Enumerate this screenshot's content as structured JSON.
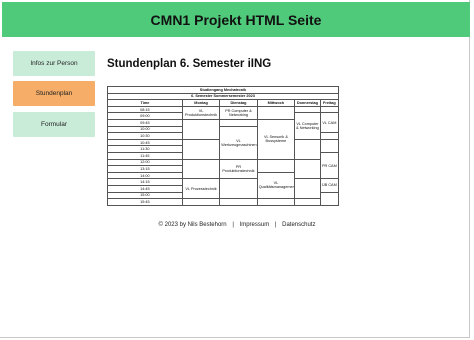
{
  "header": {
    "title": "CMN1 Projekt HTML Seite"
  },
  "nav": [
    {
      "label": "Infos zur Person",
      "active": false
    },
    {
      "label": "Stundenplan",
      "active": true
    },
    {
      "label": "Formular",
      "active": false
    }
  ],
  "colors": {
    "header": "#4fc97a",
    "nav_inactive": "#c9ecd9",
    "nav_active": "#f5ad67"
  },
  "main": {
    "title": "Stundenplan 6. Semester iING",
    "table": {
      "caption1": "Studiengang Mechatronik",
      "caption2": "6. Semester Sommersemester 2023",
      "headers": [
        "Time",
        "Montag",
        "Dienstag",
        "Mittwoch",
        "Donnerstag",
        "Freitag"
      ],
      "times": [
        "08:15",
        "09:00",
        "09:45",
        "10:00",
        "10:30",
        "10:45",
        "11:30",
        "11:45",
        "12:00",
        "13:15",
        "14:00",
        "14:15",
        "14:45",
        "15:00",
        "15:45"
      ],
      "cells": {
        "mo1": "VL Produktionstechnik",
        "di1": "PR Computer & Networking",
        "di2": "VL Werkzeugmaschinen",
        "di3": "PR Produktionstechnik",
        "mi1": "VL Sensorik & Bussysteme",
        "mi2": "VL Qualitätsmanagement",
        "do1": "VL Computer & Networking",
        "fr1": "VL CAM",
        "fr2": "PR CAM",
        "fr3": "ÜB CAM",
        "mo2": "VL Prozesstechnik"
      }
    }
  },
  "footer": {
    "copyright": "© 2023 by Nils Bestehorn",
    "sep": "|",
    "impressum": "Impressum",
    "datenschutz": "Datenschutz"
  }
}
